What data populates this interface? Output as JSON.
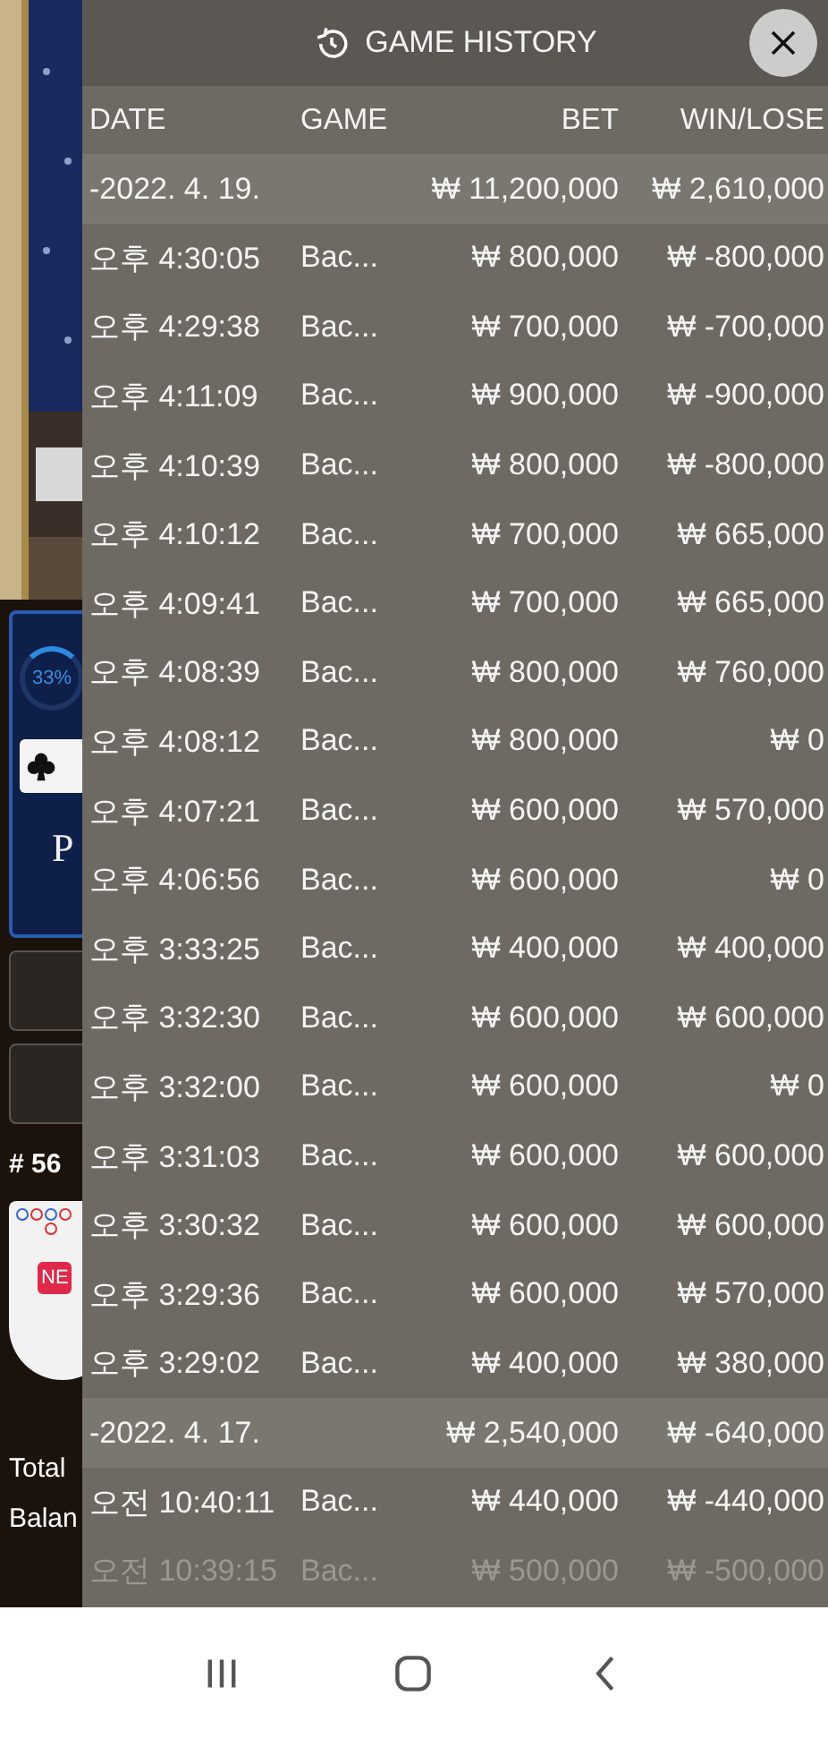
{
  "game": {
    "progress": "33%",
    "side_letter": "P",
    "round": "# 56",
    "badge": "NE",
    "total_label": "Total",
    "balance_label": "Balan"
  },
  "title": "GAME HISTORY",
  "columns": [
    "DATE",
    "GAME",
    "BET",
    "WIN/LOSE"
  ],
  "groups": [
    {
      "date": "-2022. 4. 19.",
      "bet": "₩ 11,200,000",
      "result": "₩ 2,610,000",
      "rows": [
        {
          "time": "오후 4:30:05",
          "game": "Bac...",
          "bet": "₩ 800,000",
          "result": "₩ -800,000"
        },
        {
          "time": "오후 4:29:38",
          "game": "Bac...",
          "bet": "₩ 700,000",
          "result": "₩ -700,000"
        },
        {
          "time": "오후 4:11:09",
          "game": "Bac...",
          "bet": "₩ 900,000",
          "result": "₩ -900,000"
        },
        {
          "time": "오후 4:10:39",
          "game": "Bac...",
          "bet": "₩ 800,000",
          "result": "₩ -800,000"
        },
        {
          "time": "오후 4:10:12",
          "game": "Bac...",
          "bet": "₩ 700,000",
          "result": "₩ 665,000"
        },
        {
          "time": "오후 4:09:41",
          "game": "Bac...",
          "bet": "₩ 700,000",
          "result": "₩ 665,000"
        },
        {
          "time": "오후 4:08:39",
          "game": "Bac...",
          "bet": "₩ 800,000",
          "result": "₩ 760,000"
        },
        {
          "time": "오후 4:08:12",
          "game": "Bac...",
          "bet": "₩ 800,000",
          "result": "₩ 0"
        },
        {
          "time": "오후 4:07:21",
          "game": "Bac...",
          "bet": "₩ 600,000",
          "result": "₩ 570,000"
        },
        {
          "time": "오후 4:06:56",
          "game": "Bac...",
          "bet": "₩ 600,000",
          "result": "₩ 0"
        },
        {
          "time": "오후 3:33:25",
          "game": "Bac...",
          "bet": "₩ 400,000",
          "result": "₩ 400,000"
        },
        {
          "time": "오후 3:32:30",
          "game": "Bac...",
          "bet": "₩ 600,000",
          "result": "₩ 600,000"
        },
        {
          "time": "오후 3:32:00",
          "game": "Bac...",
          "bet": "₩ 600,000",
          "result": "₩ 0"
        },
        {
          "time": "오후 3:31:03",
          "game": "Bac...",
          "bet": "₩ 600,000",
          "result": "₩ 600,000"
        },
        {
          "time": "오후 3:30:32",
          "game": "Bac...",
          "bet": "₩ 600,000",
          "result": "₩ 600,000"
        },
        {
          "time": "오후 3:29:36",
          "game": "Bac...",
          "bet": "₩ 600,000",
          "result": "₩ 570,000"
        },
        {
          "time": "오후 3:29:02",
          "game": "Bac...",
          "bet": "₩ 400,000",
          "result": "₩ 380,000"
        }
      ]
    },
    {
      "date": "-2022. 4. 17.",
      "bet": "₩ 2,540,000",
      "result": "₩ -640,000",
      "rows": [
        {
          "time": "오전 10:40:11",
          "game": "Bac...",
          "bet": "₩ 440,000",
          "result": "₩ -440,000"
        },
        {
          "time": "오전 10:39:15",
          "game": "Bac...",
          "bet": "₩ 500,000",
          "result": "₩ -500,000"
        }
      ]
    }
  ]
}
